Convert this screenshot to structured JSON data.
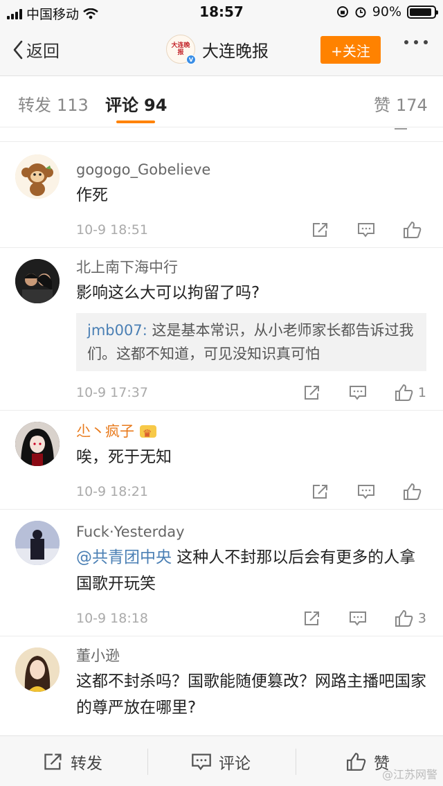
{
  "status_bar": {
    "carrier": "中国移动",
    "time": "18:57",
    "battery": "90%",
    "battery_level": 0.9
  },
  "nav": {
    "back_label": "返回",
    "title": "大连晚报",
    "logo_text": "大连晚报",
    "follow_label": "+关注"
  },
  "tabs": [
    {
      "label": "转发",
      "count": "113"
    },
    {
      "label": "评论",
      "count": "94"
    },
    {
      "label": "赞",
      "count": "174"
    }
  ],
  "comments": [
    {
      "name": "gogogo_Gobelieve",
      "text": "作死",
      "time": "10-9 18:51",
      "likes": ""
    },
    {
      "name": "北上南下海中行",
      "text": "影响这么大可以拘留了吗?",
      "quote_name": "jmb007:",
      "quote_text": " 这是基本常识，从小老师家长都告诉过我们。这都不知道，可见没知识真可怕",
      "time": "10-9 17:37",
      "likes": "1"
    },
    {
      "name": "尐丶疯子",
      "text": "唉，死于无知",
      "time": "10-9 18:21",
      "likes": ""
    },
    {
      "name": "Fuck·Yesterday",
      "mention": "@共青团中央",
      "text": " 这种人不封那以后会有更多的人拿国歌开玩笑",
      "time": "10-9 18:18",
      "likes": "3"
    },
    {
      "name": "董小逊",
      "text": "这都不封杀吗？国歌能随便篡改？网路主播吧国家的尊严放在哪里?"
    }
  ],
  "bottom_bar": {
    "repost_label": "转发",
    "comment_label": "评论",
    "like_label": "赞"
  },
  "watermark": "@江苏网警",
  "colors": {
    "accent": "#ff8200",
    "link": "#4a7fb4",
    "vip_name": "#e8791a"
  },
  "icons": [
    "back-chevron-icon",
    "share-icon",
    "comment-icon",
    "like-icon",
    "more-dots-icon"
  ]
}
